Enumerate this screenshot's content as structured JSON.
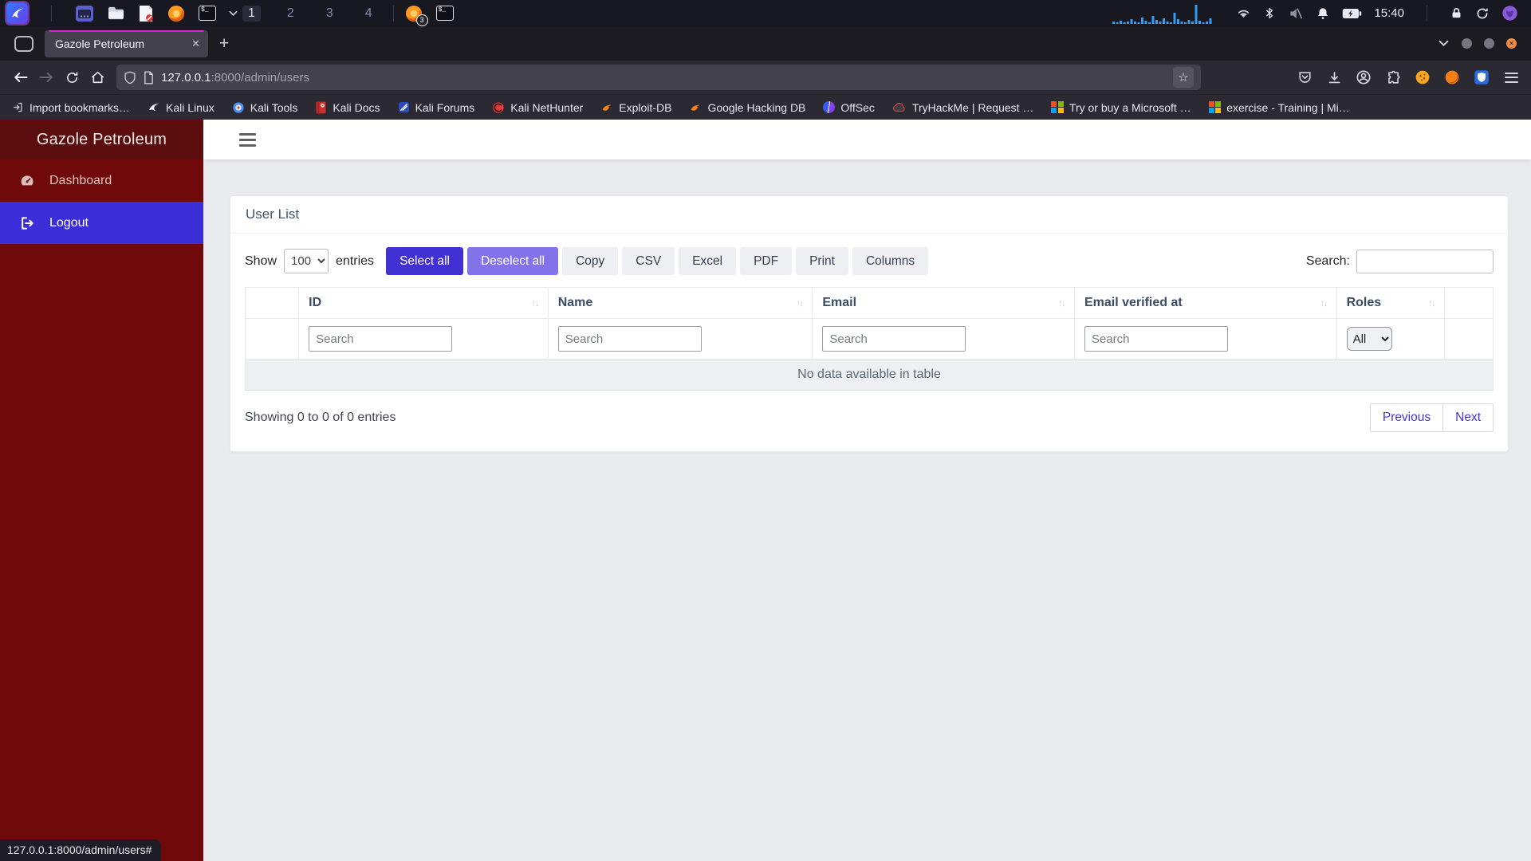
{
  "colors": {
    "sidebar_brand_bg": "#5c0d0d",
    "sidebar_bg": "#700a0a",
    "logout_bg": "#3b2dd8",
    "select_all_bg": "#4130d2",
    "deselect_all_bg": "#8273eb",
    "tab_accent": "#d02ec8",
    "link": "#4634d9",
    "graph_bar": "#2e9df5"
  },
  "taskbar": {
    "workspaces": [
      "1",
      "2",
      "3",
      "4"
    ],
    "active_workspace": "1",
    "firefox_badge": "3",
    "clock": "15:40"
  },
  "browser": {
    "tab_title": "Gazole Petroleum",
    "url_host": "127.0.0.1",
    "url_path": ":8000/admin/users",
    "new_tab_label": "+",
    "close_tab_label": "✕",
    "star_label": "☆",
    "bookmarks": [
      {
        "label": "Import bookmarks…"
      },
      {
        "label": "Kali Linux"
      },
      {
        "label": "Kali Tools"
      },
      {
        "label": "Kali Docs"
      },
      {
        "label": "Kali Forums"
      },
      {
        "label": "Kali NetHunter"
      },
      {
        "label": "Exploit-DB"
      },
      {
        "label": "Google Hacking DB"
      },
      {
        "label": "OffSec"
      },
      {
        "label": "TryHackMe | Request …"
      },
      {
        "label": "Try or buy a Microsoft …"
      },
      {
        "label": "exercise - Training | Mi…"
      }
    ],
    "status_url": "127.0.0.1:8000/admin/users#"
  },
  "sidebar": {
    "brand": "Gazole Petroleum",
    "items": [
      {
        "label": "Dashboard"
      },
      {
        "label": "Logout"
      }
    ]
  },
  "userlist": {
    "title": "User List",
    "show_label": "Show",
    "page_size": "100",
    "entries_label": "entries",
    "buttons": [
      "Select all",
      "Deselect all",
      "Copy",
      "CSV",
      "Excel",
      "PDF",
      "Print",
      "Columns"
    ],
    "search_label": "Search:",
    "table": {
      "columns": [
        "",
        "ID",
        "Name",
        "Email",
        "Email verified at",
        "Roles",
        ""
      ],
      "filter_placeholder": "Search",
      "roles_filter": "All",
      "empty_text": "No data available in table"
    },
    "info": "Showing 0 to 0 of 0 entries",
    "pagination": {
      "previous": "Previous",
      "next": "Next"
    }
  }
}
